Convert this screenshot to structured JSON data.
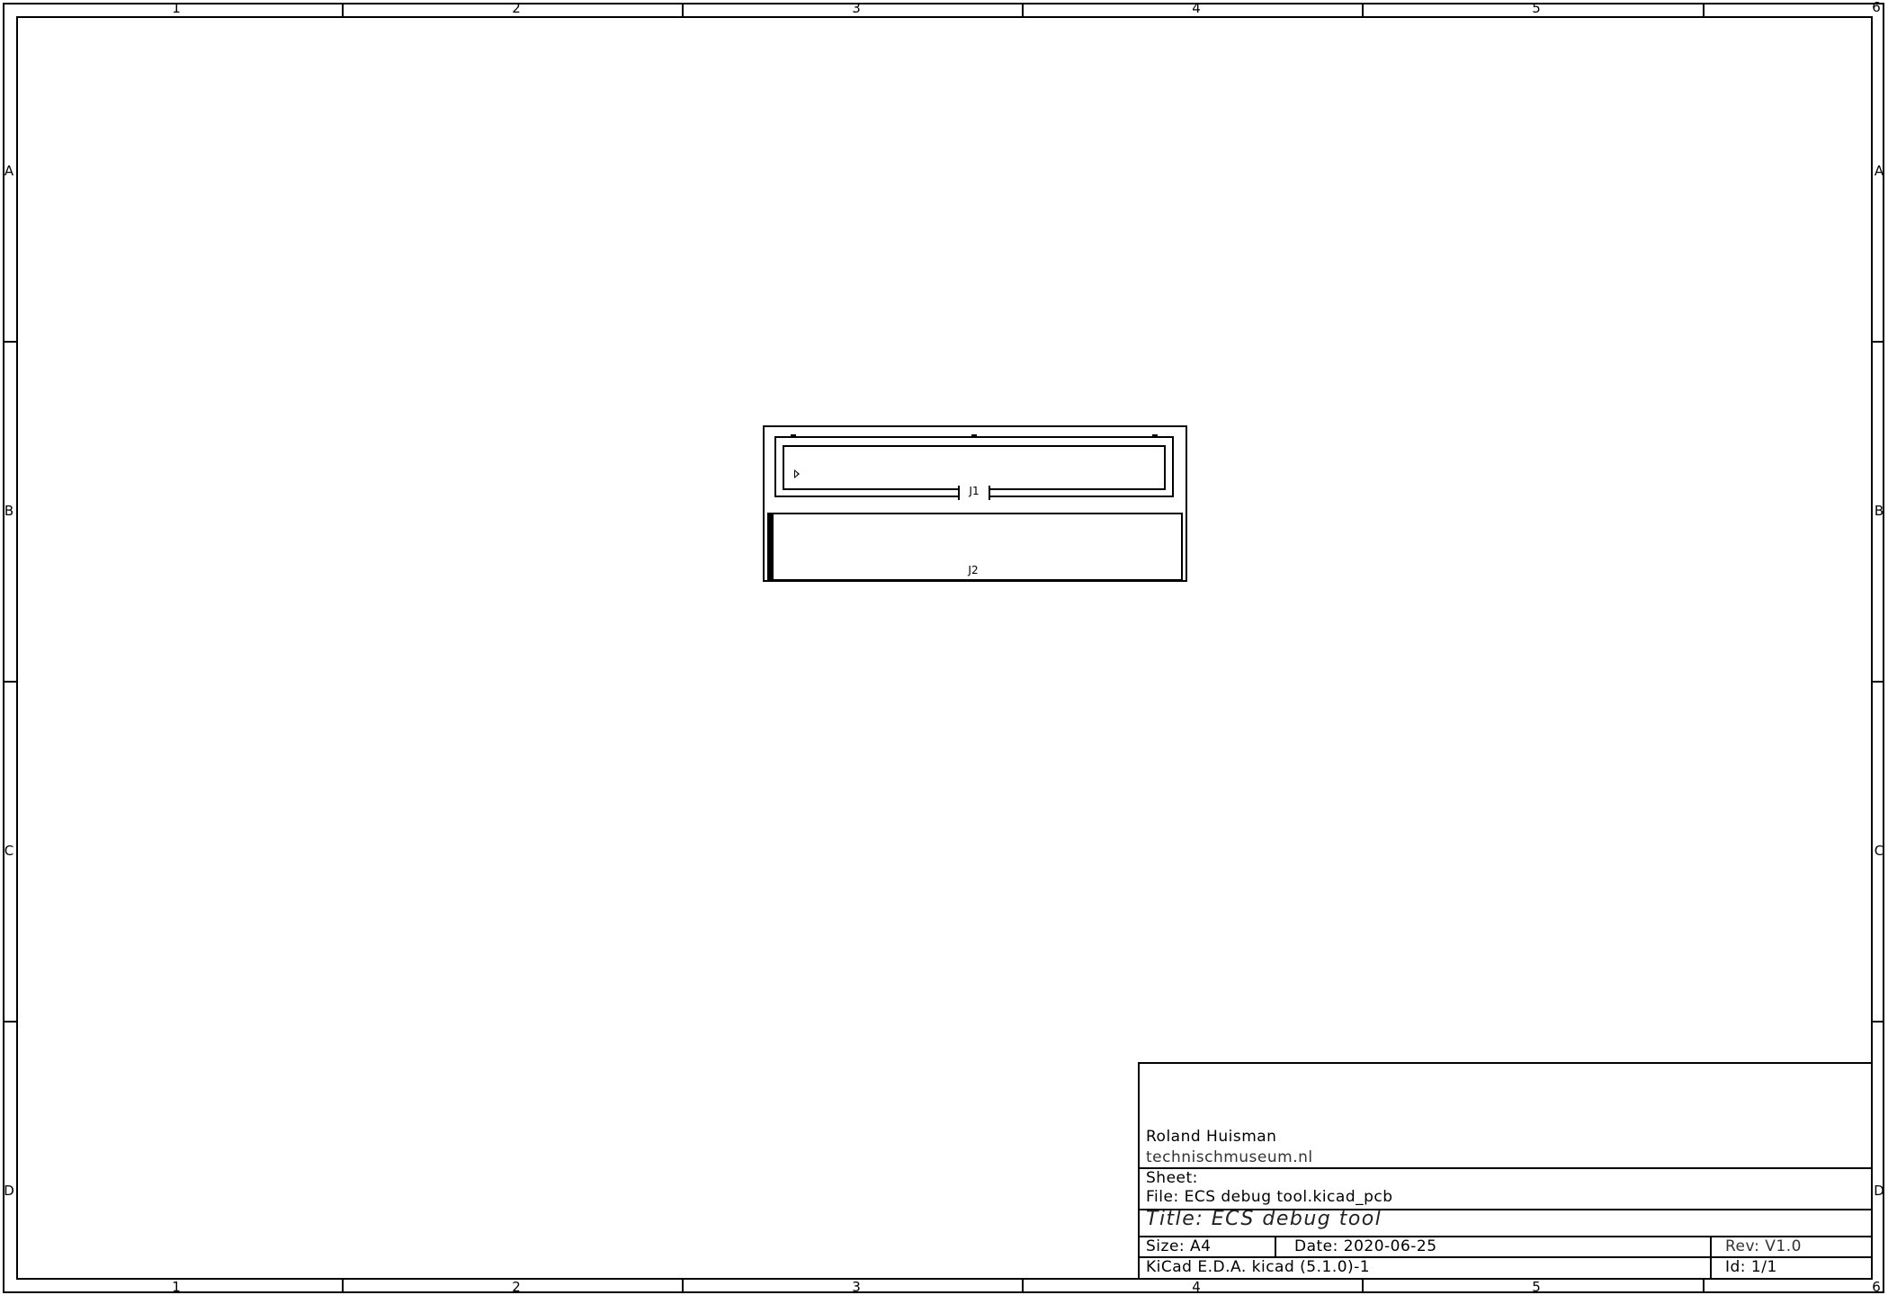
{
  "sheet": {
    "columns": [
      "1",
      "2",
      "3",
      "4",
      "5",
      "6"
    ],
    "rows": [
      "A",
      "B",
      "C",
      "D"
    ]
  },
  "layout": {
    "components": [
      {
        "ref": "J1"
      },
      {
        "ref": "J2"
      }
    ]
  },
  "title_block": {
    "company": "Roland Huisman",
    "website": "technischmuseum.nl",
    "sheet_label": "Sheet:",
    "file": "File: ECS debug tool.kicad_pcb",
    "title": "Title: ECS debug tool",
    "size": "Size: A4",
    "date": "Date: 2020-06-25",
    "rev": "Rev: V1.0",
    "tool": "KiCad E.D.A.  kicad (5.1.0)-1",
    "id": "Id: 1/1"
  }
}
